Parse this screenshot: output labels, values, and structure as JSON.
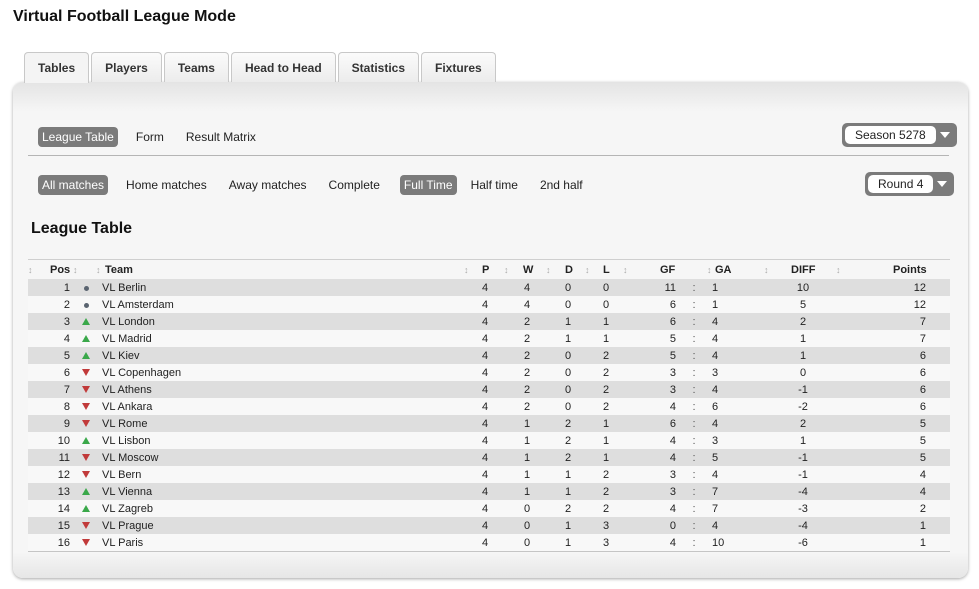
{
  "app": {
    "title": "Virtual Football League Mode"
  },
  "tabs": [
    {
      "label": "Tables",
      "active": true
    },
    {
      "label": "Players",
      "active": false
    },
    {
      "label": "Teams",
      "active": false
    },
    {
      "label": "Head to Head",
      "active": false
    },
    {
      "label": "Statistics",
      "active": false
    },
    {
      "label": "Fixtures",
      "active": false
    }
  ],
  "view_filters": [
    {
      "label": "League Table",
      "active": true
    },
    {
      "label": "Form",
      "active": false
    },
    {
      "label": "Result Matrix",
      "active": false
    }
  ],
  "season_select": {
    "value": "Season 5278",
    "icon": "chevron-down-icon"
  },
  "match_filters": [
    {
      "label": "All matches",
      "active": true
    },
    {
      "label": "Home matches",
      "active": false
    },
    {
      "label": "Away matches",
      "active": false
    },
    {
      "label": "Complete",
      "active": false
    }
  ],
  "time_filters": [
    {
      "label": "Full Time",
      "active": true
    },
    {
      "label": "Half time",
      "active": false
    },
    {
      "label": "2nd half",
      "active": false
    }
  ],
  "round_select": {
    "value": "Round 4",
    "icon": "chevron-down-icon"
  },
  "section_title": "League Table",
  "colors": {
    "active_pill": "#7b7b7b",
    "trend_up": "#3aa84a",
    "trend_down": "#c13a3a",
    "trend_same": "#5a6470"
  },
  "table": {
    "headers": {
      "pos": "Pos",
      "team": "Team",
      "p": "P",
      "w": "W",
      "d": "D",
      "l": "L",
      "gf": "GF",
      "ga": "GA",
      "diff": "DIFF",
      "points": "Points"
    },
    "sort_icon": "↕",
    "separator": ":",
    "rows": [
      {
        "pos": "1",
        "trend": "same",
        "team": "VL Berlin",
        "p": "4",
        "w": "4",
        "d": "0",
        "l": "0",
        "gf": "11",
        "ga": "1",
        "diff": "10",
        "points": "12"
      },
      {
        "pos": "2",
        "trend": "same",
        "team": "VL Amsterdam",
        "p": "4",
        "w": "4",
        "d": "0",
        "l": "0",
        "gf": "6",
        "ga": "1",
        "diff": "5",
        "points": "12"
      },
      {
        "pos": "3",
        "trend": "up",
        "team": "VL London",
        "p": "4",
        "w": "2",
        "d": "1",
        "l": "1",
        "gf": "6",
        "ga": "4",
        "diff": "2",
        "points": "7"
      },
      {
        "pos": "4",
        "trend": "up",
        "team": "VL Madrid",
        "p": "4",
        "w": "2",
        "d": "1",
        "l": "1",
        "gf": "5",
        "ga": "4",
        "diff": "1",
        "points": "7"
      },
      {
        "pos": "5",
        "trend": "up",
        "team": "VL Kiev",
        "p": "4",
        "w": "2",
        "d": "0",
        "l": "2",
        "gf": "5",
        "ga": "4",
        "diff": "1",
        "points": "6"
      },
      {
        "pos": "6",
        "trend": "down",
        "team": "VL Copenhagen",
        "p": "4",
        "w": "2",
        "d": "0",
        "l": "2",
        "gf": "3",
        "ga": "3",
        "diff": "0",
        "points": "6"
      },
      {
        "pos": "7",
        "trend": "down",
        "team": "VL Athens",
        "p": "4",
        "w": "2",
        "d": "0",
        "l": "2",
        "gf": "3",
        "ga": "4",
        "diff": "-1",
        "points": "6"
      },
      {
        "pos": "8",
        "trend": "down",
        "team": "VL Ankara",
        "p": "4",
        "w": "2",
        "d": "0",
        "l": "2",
        "gf": "4",
        "ga": "6",
        "diff": "-2",
        "points": "6"
      },
      {
        "pos": "9",
        "trend": "down",
        "team": "VL Rome",
        "p": "4",
        "w": "1",
        "d": "2",
        "l": "1",
        "gf": "6",
        "ga": "4",
        "diff": "2",
        "points": "5"
      },
      {
        "pos": "10",
        "trend": "up",
        "team": "VL Lisbon",
        "p": "4",
        "w": "1",
        "d": "2",
        "l": "1",
        "gf": "4",
        "ga": "3",
        "diff": "1",
        "points": "5"
      },
      {
        "pos": "11",
        "trend": "down",
        "team": "VL Moscow",
        "p": "4",
        "w": "1",
        "d": "2",
        "l": "1",
        "gf": "4",
        "ga": "5",
        "diff": "-1",
        "points": "5"
      },
      {
        "pos": "12",
        "trend": "down",
        "team": "VL Bern",
        "p": "4",
        "w": "1",
        "d": "1",
        "l": "2",
        "gf": "3",
        "ga": "4",
        "diff": "-1",
        "points": "4"
      },
      {
        "pos": "13",
        "trend": "up",
        "team": "VL Vienna",
        "p": "4",
        "w": "1",
        "d": "1",
        "l": "2",
        "gf": "3",
        "ga": "7",
        "diff": "-4",
        "points": "4"
      },
      {
        "pos": "14",
        "trend": "up",
        "team": "VL Zagreb",
        "p": "4",
        "w": "0",
        "d": "2",
        "l": "2",
        "gf": "4",
        "ga": "7",
        "diff": "-3",
        "points": "2"
      },
      {
        "pos": "15",
        "trend": "down",
        "team": "VL Prague",
        "p": "4",
        "w": "0",
        "d": "1",
        "l": "3",
        "gf": "0",
        "ga": "4",
        "diff": "-4",
        "points": "1"
      },
      {
        "pos": "16",
        "trend": "down",
        "team": "VL Paris",
        "p": "4",
        "w": "0",
        "d": "1",
        "l": "3",
        "gf": "4",
        "ga": "10",
        "diff": "-6",
        "points": "1"
      }
    ]
  }
}
